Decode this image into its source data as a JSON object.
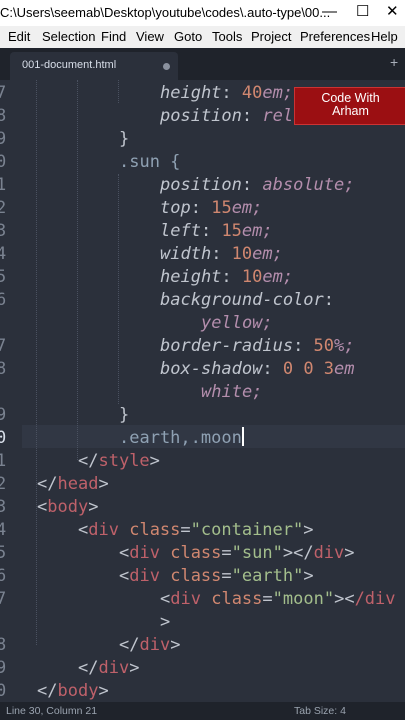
{
  "window": {
    "title": "C:\\Users\\seemab\\Desktop\\youtube\\codes\\.auto-type\\00...",
    "minimize_glyph": "—",
    "maximize_glyph": "☐",
    "close_glyph": "✕"
  },
  "menu": [
    "Edit",
    "Selection",
    "Find",
    "View",
    "Goto",
    "Tools",
    "Project",
    "Preferences",
    "Help"
  ],
  "tab": {
    "label": "001-document.html",
    "new_tab_glyph": "+"
  },
  "watermark": {
    "line1": "Code With",
    "line2": "Arham"
  },
  "line_numbers": [
    "7",
    "8",
    "9",
    "0",
    "1",
    "2",
    "3",
    "4",
    "5",
    "6",
    "",
    "7",
    "8",
    "",
    "9",
    "0",
    "1",
    "2",
    "3",
    "4",
    "5",
    "6",
    "7",
    "",
    "8",
    "9",
    "0"
  ],
  "code": {
    "l7": {
      "prop": "height",
      "val": "40em;"
    },
    "l8": {
      "prop": "position",
      "val": "rel"
    },
    "l9": "}",
    "l10": ".sun {",
    "l11": {
      "prop": "position",
      "val": "absolute;"
    },
    "l12": {
      "prop": "top",
      "num": "15",
      "unit": "em;"
    },
    "l13": {
      "prop": "left",
      "num": "15",
      "unit": "em;"
    },
    "l14": {
      "prop": "width",
      "num": "10",
      "unit": "em;"
    },
    "l15": {
      "prop": "height",
      "num": "10",
      "unit": "em;"
    },
    "l16": {
      "prop": "background-color",
      "val": "yellow;"
    },
    "l17": {
      "prop": "border-radius",
      "num": "50",
      "unit": "%;"
    },
    "l18": {
      "prop": "box-shadow",
      "num": "0 0 3",
      "unit": "em",
      "val": "white;"
    },
    "l19": "}",
    "l20": ".earth,.moon",
    "l21": "style",
    "l22": "head",
    "l23": "body",
    "l24": {
      "tag": "div",
      "attr": "class",
      "str": "\"container\""
    },
    "l25": {
      "tag": "div",
      "attr": "class",
      "str": "\"sun\"",
      "close": "div"
    },
    "l26": {
      "tag": "div",
      "attr": "class",
      "str": "\"earth\""
    },
    "l27": {
      "tag": "div",
      "attr": "class",
      "str": "\"moon\"",
      "close": "/div"
    },
    "l27b": ">",
    "l28": "div",
    "l29": "div",
    "l30": "body"
  },
  "status": {
    "position": "Line 30, Column 21",
    "tab_size": "Tab Size: 4"
  }
}
